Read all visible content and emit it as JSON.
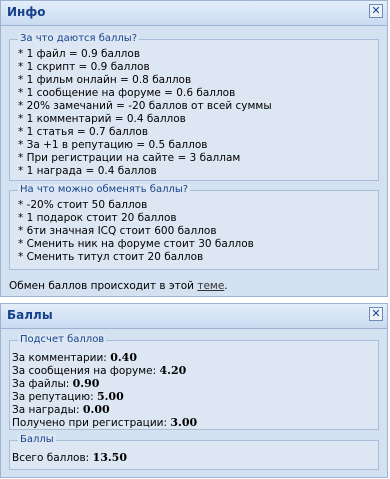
{
  "info_panel": {
    "title": "Инфо",
    "earn_section": {
      "legend": "За что даются баллы?",
      "items": [
        "* 1 файл = 0.9 баллов",
        "* 1 скрипт = 0.9 баллов",
        "* 1 фильм онлайн = 0.8 баллов",
        "* 1 сообщение на форуме = 0.6 баллов",
        "* 20% замечаний = -20 баллов от всей суммы",
        "* 1 комментарий = 0.4 баллов",
        "* 1 статья = 0.7 баллов",
        "* За +1 в репутацию = 0.5 баллов",
        "* При регистрации на сайте = 3 баллам",
        "* 1 награда = 0.4 баллов"
      ]
    },
    "spend_section": {
      "legend": "На что можно обменять баллы?",
      "items": [
        "* -20% стоит 50 баллов",
        "* 1 подарок стоит 20 баллов",
        "* 6ти значная ICQ стоит 600 баллов",
        "* Сменить ник на форуме стоит 30 баллов",
        "* Сменить титул стоит 20 баллов"
      ]
    },
    "exchange_note": {
      "prefix": "Обмен баллов происходит в этой ",
      "link": "теме",
      "suffix": "."
    }
  },
  "points_panel": {
    "title": "Баллы",
    "count_section": {
      "legend": "Подсчет баллов",
      "rows": [
        {
          "label": "За комментарии: ",
          "value": "0.40"
        },
        {
          "label": "За сообщения на форуме: ",
          "value": "4.20"
        },
        {
          "label": "За файлы: ",
          "value": "0.90"
        },
        {
          "label": "За репутацию: ",
          "value": "5.00"
        },
        {
          "label": "За награды: ",
          "value": "0.00"
        },
        {
          "label": "Получено при регистрации: ",
          "value": "3.00"
        }
      ]
    },
    "total_section": {
      "legend": "Баллы",
      "label": "Всего баллов: ",
      "value": "13.50"
    }
  },
  "close_glyph": "✕"
}
